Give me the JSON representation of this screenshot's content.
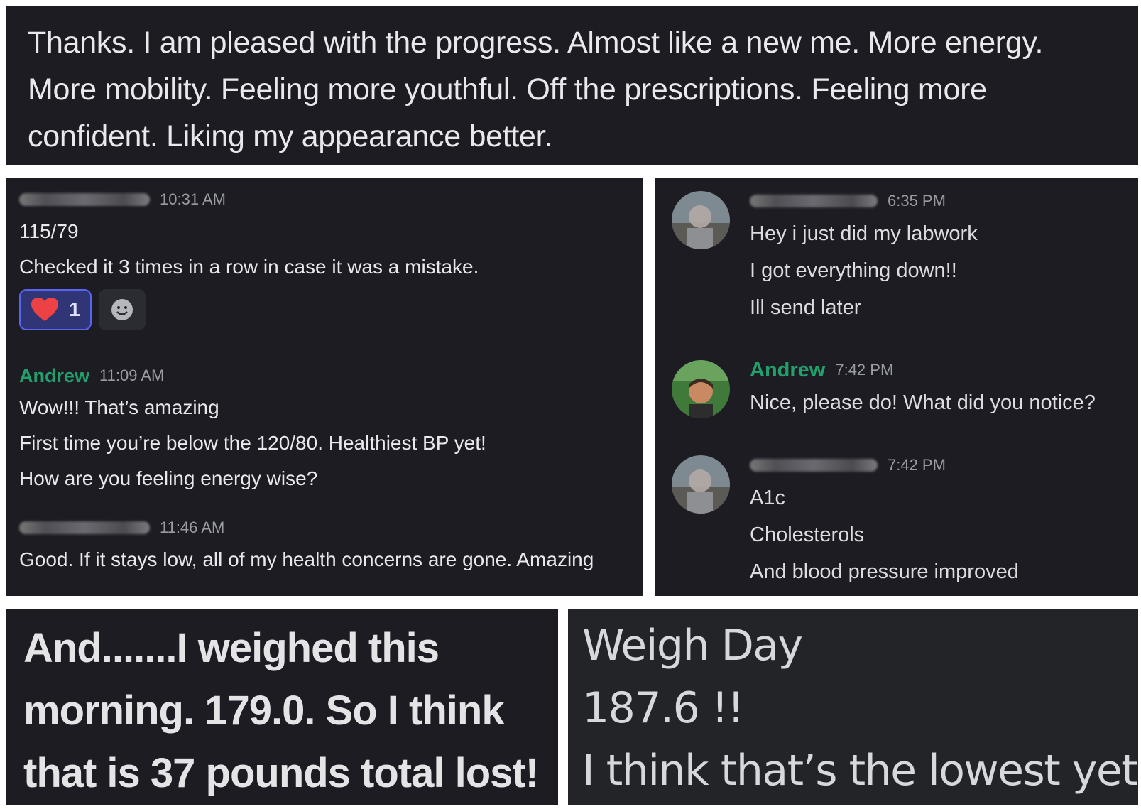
{
  "top_quote": {
    "lines": [
      "Thanks.  I am pleased with the progress. Almost like a new me. More energy.",
      "More mobility. Feeling more youthful. Off the prescriptions. Feeling more",
      "confident. Liking my appearance better."
    ]
  },
  "left_chat": {
    "msg1": {
      "time": "10:31 AM",
      "lines": [
        "115/79",
        "Checked it 3 times in a row in case it was a mistake."
      ],
      "reaction_count": "1"
    },
    "msg2": {
      "author": "Andrew",
      "time": "11:09 AM",
      "lines": [
        "Wow!!! That’s amazing",
        "First time you’re below the 120/80. Healthiest BP yet!",
        "How are you feeling energy wise?"
      ]
    },
    "msg3": {
      "time": "11:46 AM",
      "lines": [
        "Good. If it stays low, all of my health concerns are gone. Amazing"
      ]
    }
  },
  "right_chat": {
    "msg1": {
      "time": "6:35 PM",
      "lines": [
        "Hey i just did my labwork",
        "I got everything down!!",
        "Ill send later"
      ]
    },
    "msg2": {
      "author": "Andrew",
      "time": "7:42 PM",
      "lines": [
        "Nice, please do! What did you notice?"
      ]
    },
    "msg3": {
      "time": "7:42 PM",
      "lines": [
        "A1c",
        "Cholesterols",
        "And blood pressure improved"
      ]
    }
  },
  "bottom_left": {
    "lines": [
      "And.......I weighed this",
      "morning. 179.0. So I think",
      "that is 37 pounds total lost!"
    ]
  },
  "bottom_right": {
    "lines": [
      "Weigh Day",
      "187.6 !!",
      "I think that’s the lowest yet"
    ]
  },
  "colors": {
    "panel_bg": "#1c1c22",
    "author_green": "#22a06b",
    "reaction_blue": "#5865f2",
    "heart_red": "#ed4245"
  }
}
